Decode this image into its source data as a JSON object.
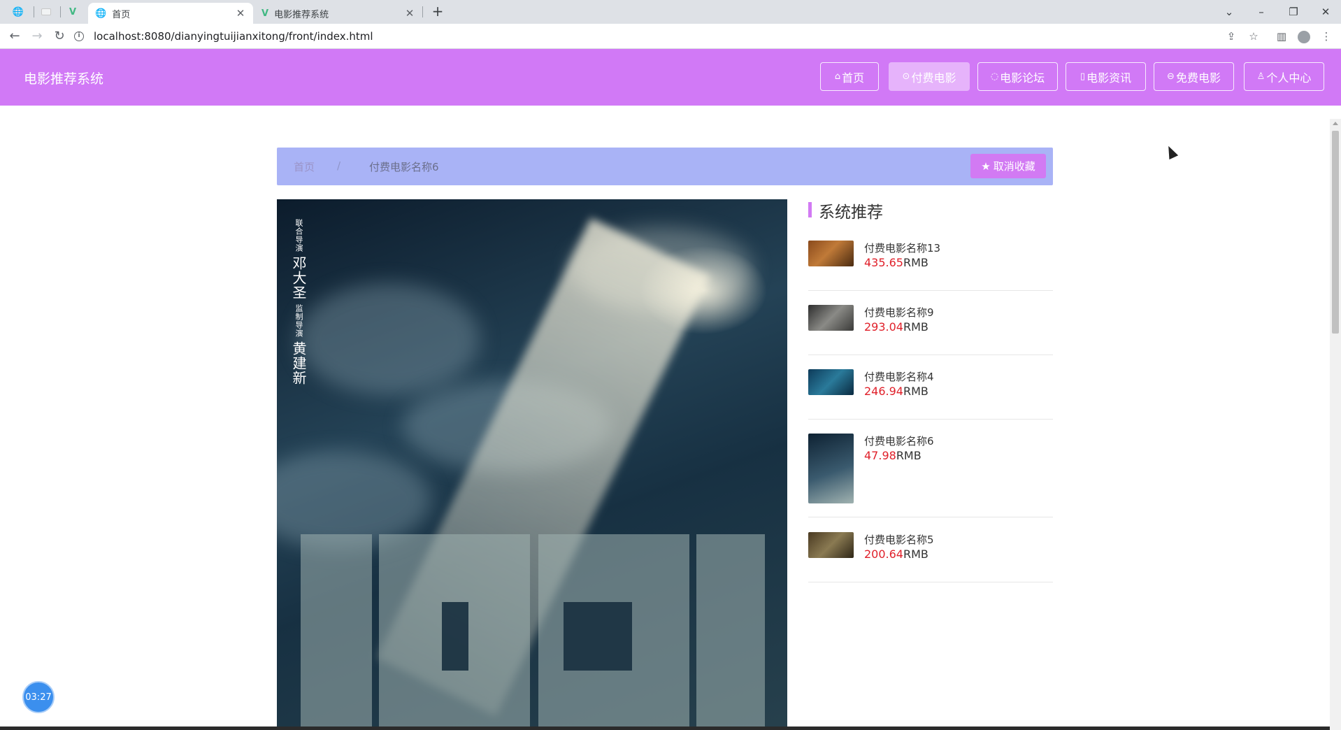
{
  "browser": {
    "tabs": [
      {
        "title": "首页",
        "icon": "globe-icon",
        "active": true
      },
      {
        "title": "电影推荐系统",
        "icon": "vue-logo-icon",
        "active": false
      }
    ],
    "pinned_icons": [
      "globe-icon",
      "blank-page-icon",
      "vue-logo-icon"
    ],
    "url": "localhost:8080/dianyingtuijianxitong/front/index.html",
    "window_controls": {
      "chevron": "⌄",
      "minimize": "–",
      "restore": "❐",
      "close": "✕"
    }
  },
  "site": {
    "title": "电影推荐系统",
    "accent_color": "#d179f6",
    "nav": [
      {
        "label": "首页",
        "icon": "home-icon",
        "active": false
      },
      {
        "label": "付费电影",
        "icon": "film-reel-icon",
        "active": true
      },
      {
        "label": "电影论坛",
        "icon": "forum-bubble-icon",
        "active": false
      },
      {
        "label": "电影资讯",
        "icon": "news-icon",
        "active": false
      },
      {
        "label": "免费电影",
        "icon": "ticket-icon",
        "active": false
      },
      {
        "label": "个人中心",
        "icon": "user-icon",
        "active": false
      }
    ]
  },
  "breadcrumb": {
    "home": "首页",
    "separator": "/",
    "current": "付费电影名称6"
  },
  "favorite_button": {
    "label": "取消收藏",
    "icon": "star-icon"
  },
  "poster": {
    "credits_col1": "联合导演",
    "credits_col2": "邓大圣",
    "credits_col3": "监制导演",
    "credits_col4": "黄建新"
  },
  "recommendations": {
    "title": "系统推荐",
    "price_color": "#e0202a",
    "currency": "RMB",
    "items": [
      {
        "name": "付费电影名称13",
        "price": "435.65"
      },
      {
        "name": "付费电影名称9",
        "price": "293.04"
      },
      {
        "name": "付费电影名称4",
        "price": "246.94"
      },
      {
        "name": "付费电影名称6",
        "price": "47.98"
      },
      {
        "name": "付费电影名称5",
        "price": "200.64"
      }
    ]
  },
  "timer": "03:27"
}
